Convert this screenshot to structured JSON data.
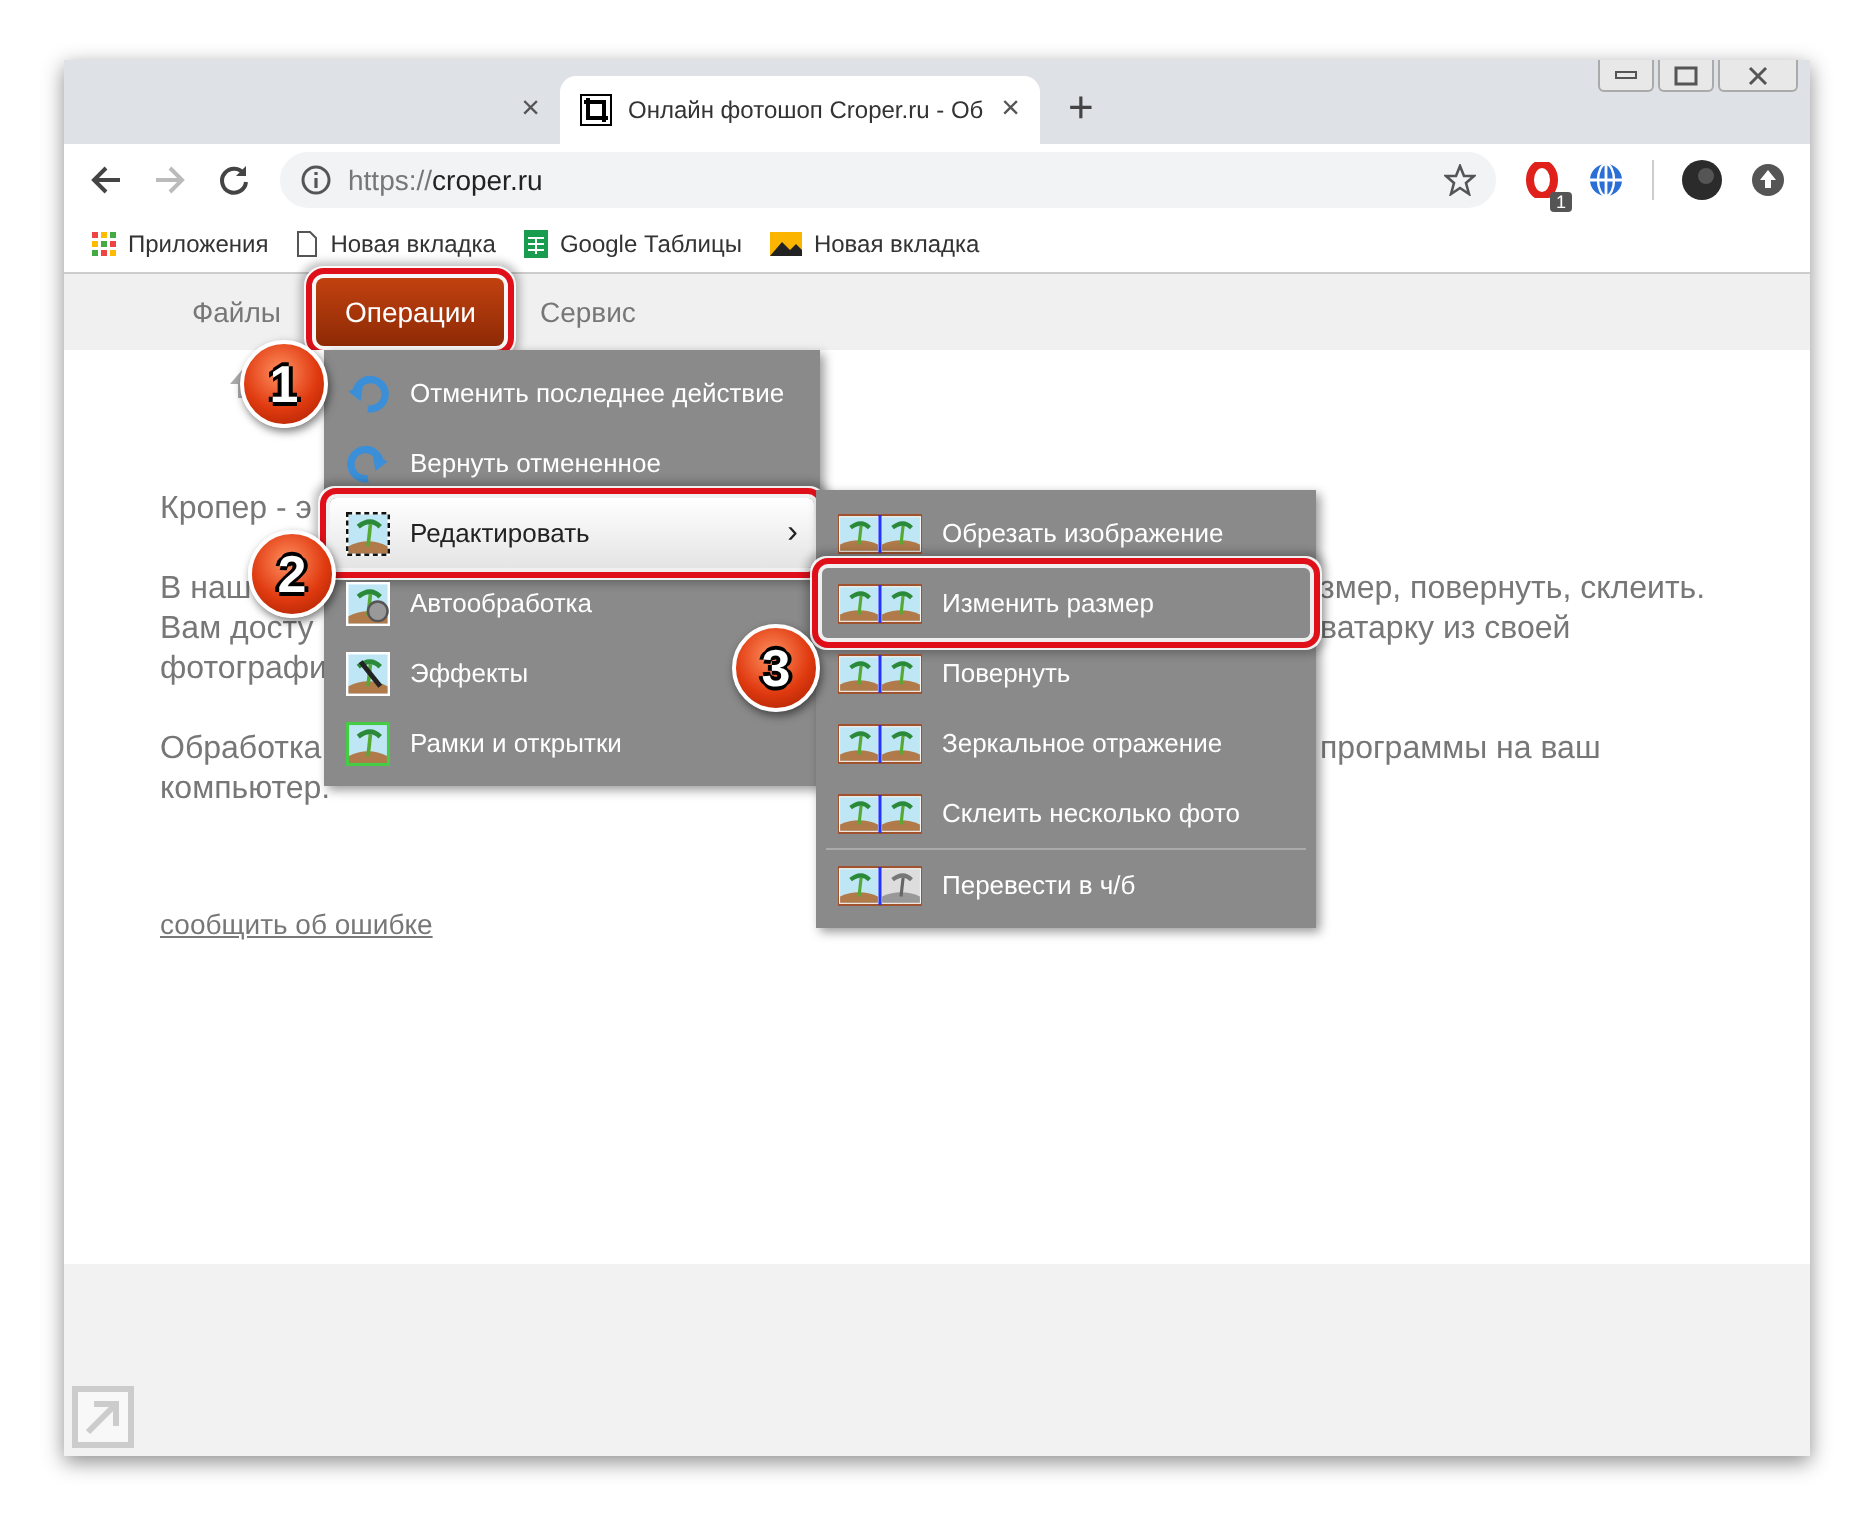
{
  "tabs": [
    {
      "selected": false,
      "close": "×"
    },
    {
      "title": "Онлайн фотошоп Croper.ru - Об",
      "selected": true,
      "close": "×"
    }
  ],
  "new_tab": "+",
  "address_bar": {
    "scheme": "https://",
    "host": "croper.ru"
  },
  "extension_badge": "1",
  "bookmarks": [
    "Приложения",
    "Новая вкладка",
    "Google Таблицы",
    "Новая вкладка"
  ],
  "site_menu": [
    {
      "label": "Файлы",
      "selected": false,
      "outlined": false
    },
    {
      "label": "Операции",
      "selected": true,
      "outlined": true
    },
    {
      "label": "Сервис",
      "selected": false,
      "outlined": false
    }
  ],
  "text_lines": [
    {
      "left": "Кропер - э"
    },
    {
      "left": "В наш",
      "right": "змер, повернуть, склеить."
    },
    {
      "left": "Вам досту",
      "right": "ватарку из своей"
    },
    {
      "left": "фотографи"
    },
    {
      "left": "Обработка",
      "right": "программы на ваш"
    },
    {
      "left": "компьютер."
    }
  ],
  "report_link": "сообщить об ошибке",
  "operations_menu": [
    {
      "label": "Отменить последнее действие",
      "highlighted": false,
      "outlined": false
    },
    {
      "label": "Вернуть отмененное",
      "highlighted": false,
      "outlined": false
    },
    {
      "label": "Редактировать",
      "highlighted": true,
      "outlined": true,
      "arrow": "›"
    },
    {
      "label": "Автообработка",
      "highlighted": false,
      "outlined": false
    },
    {
      "label": "Эффекты",
      "highlighted": false,
      "outlined": false
    },
    {
      "label": "Рамки и открытки",
      "highlighted": false,
      "outlined": false
    }
  ],
  "edit_submenu": [
    {
      "label": "Обрезать изображение",
      "outlined": false,
      "separator_before": false
    },
    {
      "label": "Изменить размер",
      "outlined": true,
      "separator_before": false
    },
    {
      "label": "Повернуть",
      "outlined": false,
      "separator_before": false
    },
    {
      "label": "Зеркальное отражение",
      "outlined": false,
      "separator_before": false
    },
    {
      "label": "Склеить несколько фото",
      "outlined": false,
      "separator_before": false
    },
    {
      "label": "Перевести в ч/б",
      "outlined": false,
      "separator_before": true
    }
  ],
  "step_badges": [
    "1",
    "2",
    "3"
  ]
}
